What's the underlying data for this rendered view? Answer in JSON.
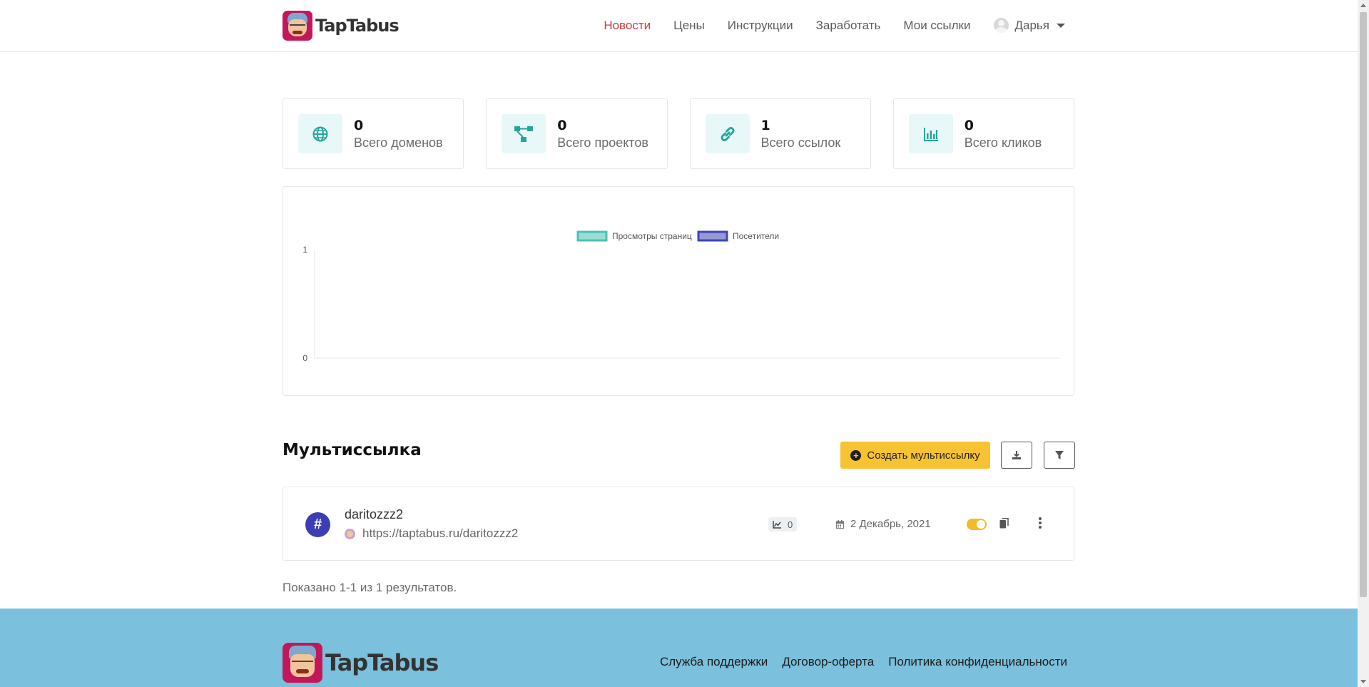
{
  "brand": {
    "name": "TapTabus"
  },
  "nav": {
    "items": [
      {
        "label": "Новости",
        "active": true
      },
      {
        "label": "Цены"
      },
      {
        "label": "Инструкции"
      },
      {
        "label": "Заработать"
      },
      {
        "label": "Мои ссылки"
      }
    ],
    "user": "Дарья"
  },
  "stats": [
    {
      "value": "0",
      "label": "Всего доменов",
      "icon": "globe-icon"
    },
    {
      "value": "0",
      "label": "Всего проектов",
      "icon": "project-tree-icon"
    },
    {
      "value": "1",
      "label": "Всего ссылок",
      "icon": "link-icon"
    },
    {
      "value": "0",
      "label": "Всего кликов",
      "icon": "bar-chart-icon"
    }
  ],
  "chart_data": {
    "type": "line",
    "series": [
      {
        "name": "Просмотры страниц",
        "color": "#4dc0b5",
        "values": []
      },
      {
        "name": "Посетители",
        "color": "#3f46b3",
        "values": []
      }
    ],
    "ylim": [
      0,
      1
    ],
    "yticks": [
      "1",
      "0"
    ],
    "legend": "top-center"
  },
  "section": {
    "title": "Мультиссылка",
    "create_label": "Создать мультиссылку"
  },
  "links": [
    {
      "name": "daritozzz2",
      "url": "https://taptabus.ru/daritozzz2",
      "clicks": "0",
      "date": "2 Декабрь, 2021",
      "enabled": true
    }
  ],
  "results_text": "Показано 1-1 из 1 результатов.",
  "footer": {
    "links": [
      "Служба поддержки",
      "Договор-оферта",
      "Политика конфиденциальности"
    ]
  },
  "colors": {
    "accent": "#f7c333",
    "teal": "#4dc0b5",
    "indigo": "#3c3fb3",
    "footer": "#7bc0dd",
    "nav_active": "#d03a3a"
  }
}
